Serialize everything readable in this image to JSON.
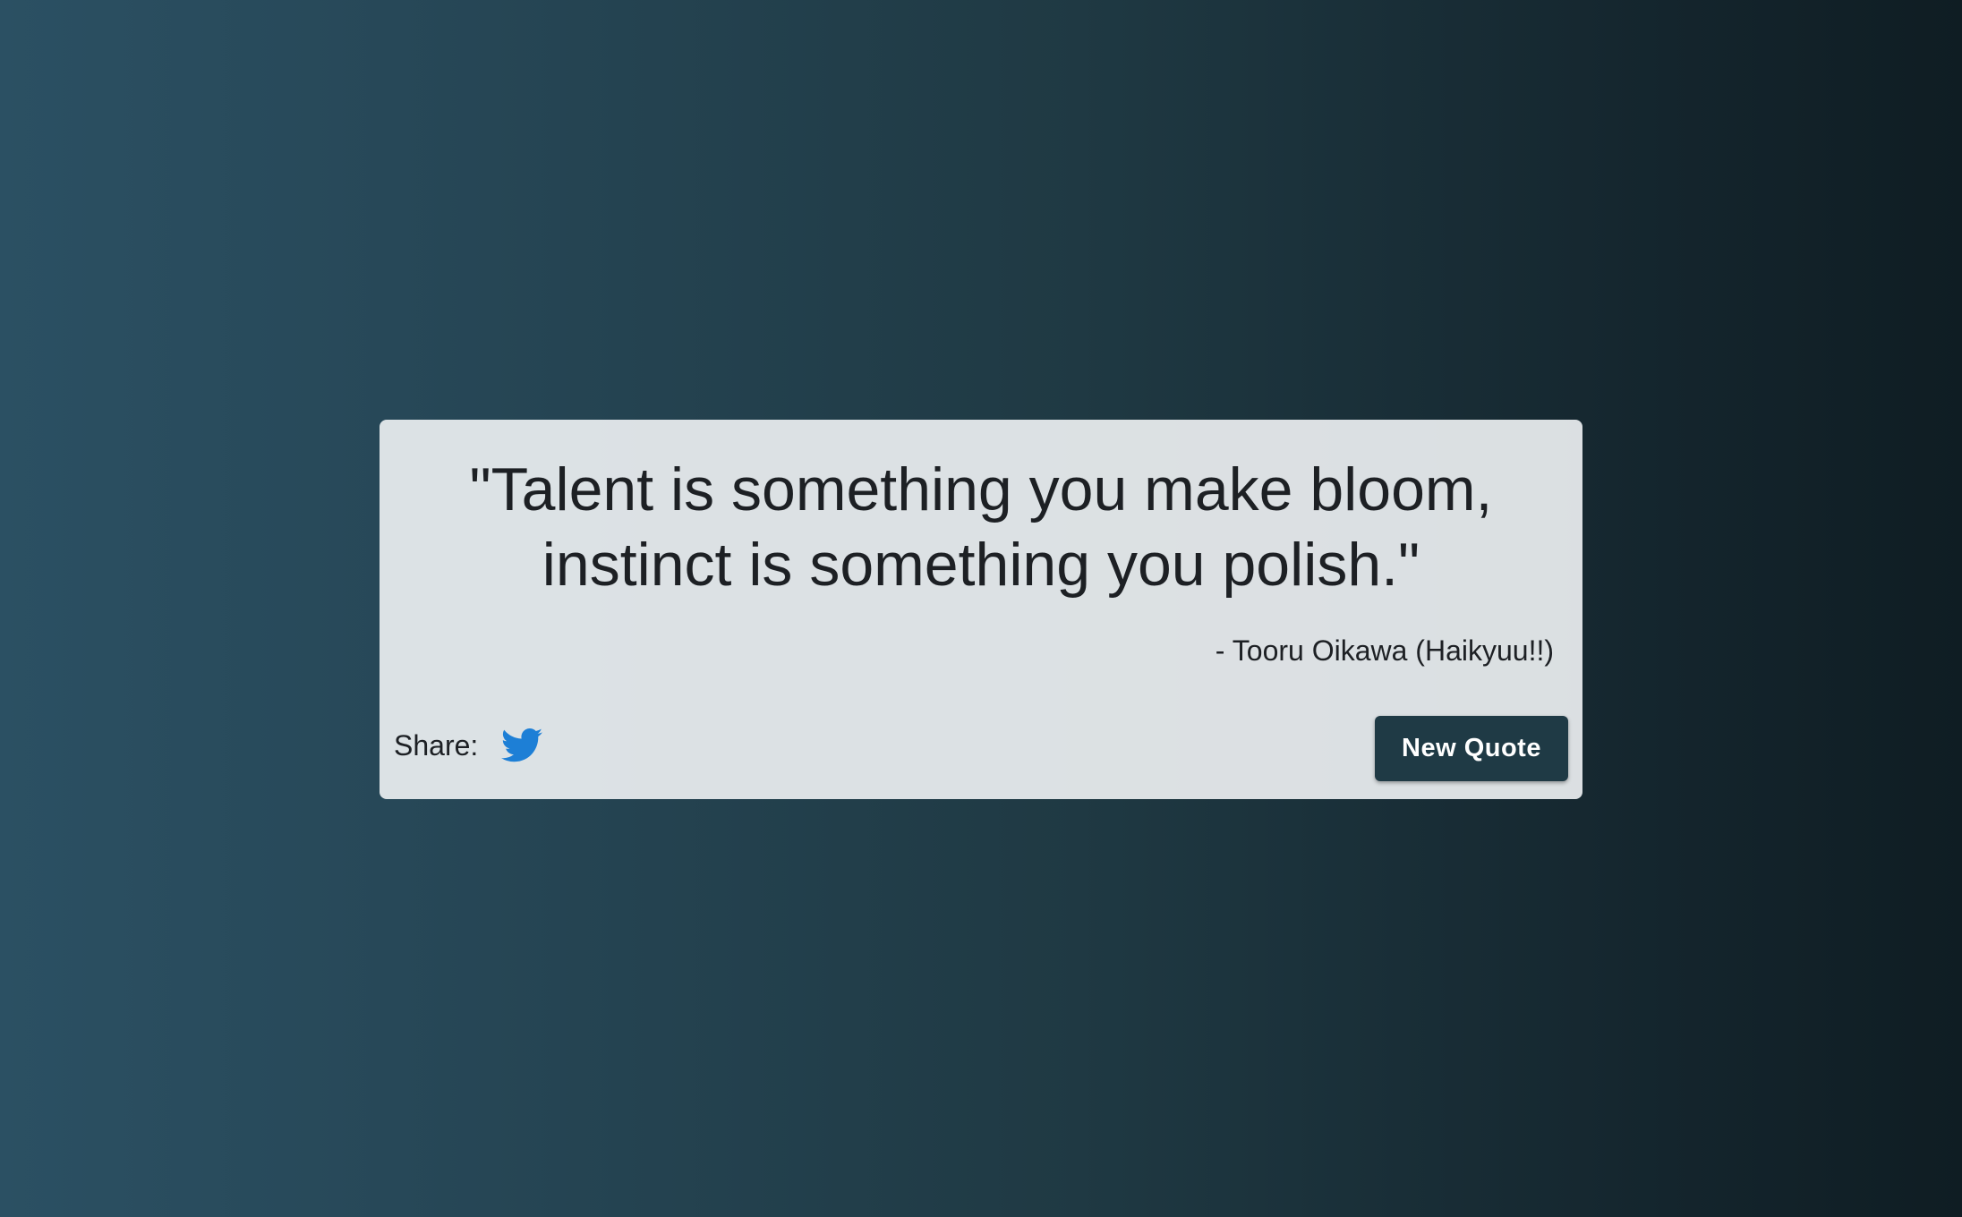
{
  "quote": {
    "text": "\"Talent is something you make bloom, instinct is something you polish.\"",
    "author": "- Tooru Oikawa (Haikyuu!!)"
  },
  "share": {
    "label": "Share:",
    "icon": "twitter-icon",
    "icon_color": "#1d7fd6"
  },
  "actions": {
    "new_quote_label": "New Quote",
    "button_color": "#1f3a45"
  }
}
